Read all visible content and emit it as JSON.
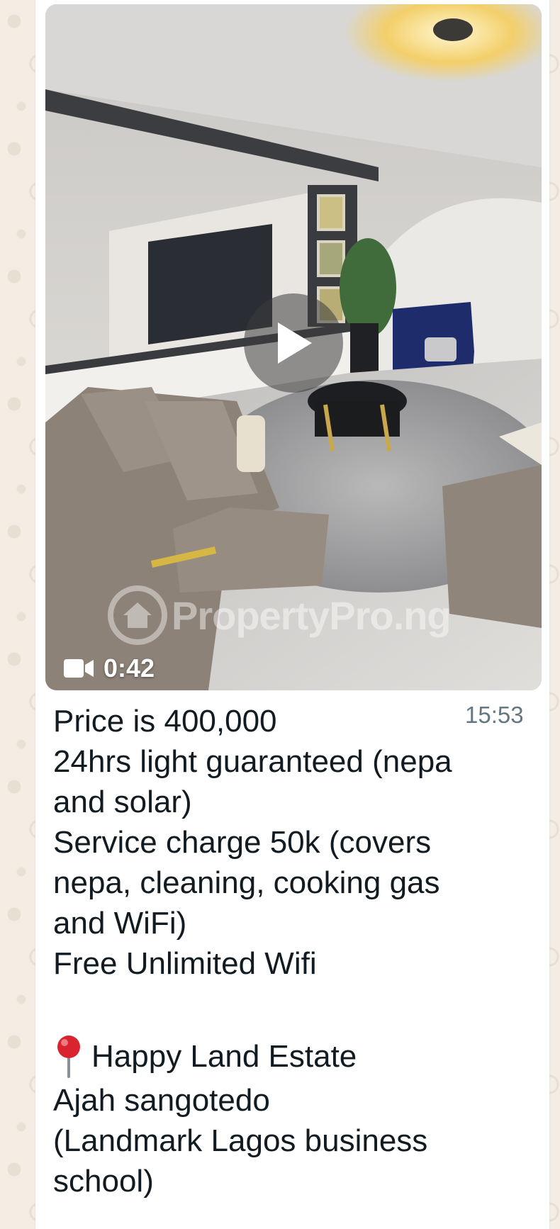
{
  "video": {
    "duration": "0:42",
    "watermark": "PropertyPro.ng",
    "play_icon": "play-icon",
    "camera_icon": "video-camera-icon"
  },
  "message": {
    "time": "15:53",
    "lines": [
      "Price is  400,000",
      "24hrs light guaranteed (nepa",
      "and solar)",
      "Service charge 50k (covers",
      "nepa, cleaning, cooking gas",
      "and WiFi)",
      "Free Unlimited Wifi"
    ],
    "location": {
      "icon": "pin-icon",
      "name": "Happy Land Estate"
    },
    "address_lines": [
      "Ajah sangotedo",
      "(Landmark Lagos business",
      "school)"
    ]
  },
  "colors": {
    "wallpaper": "#f3ede3",
    "bubble": "#ffffff",
    "text": "#111b21",
    "timestamp": "#667781",
    "pin": "#d9232e"
  }
}
